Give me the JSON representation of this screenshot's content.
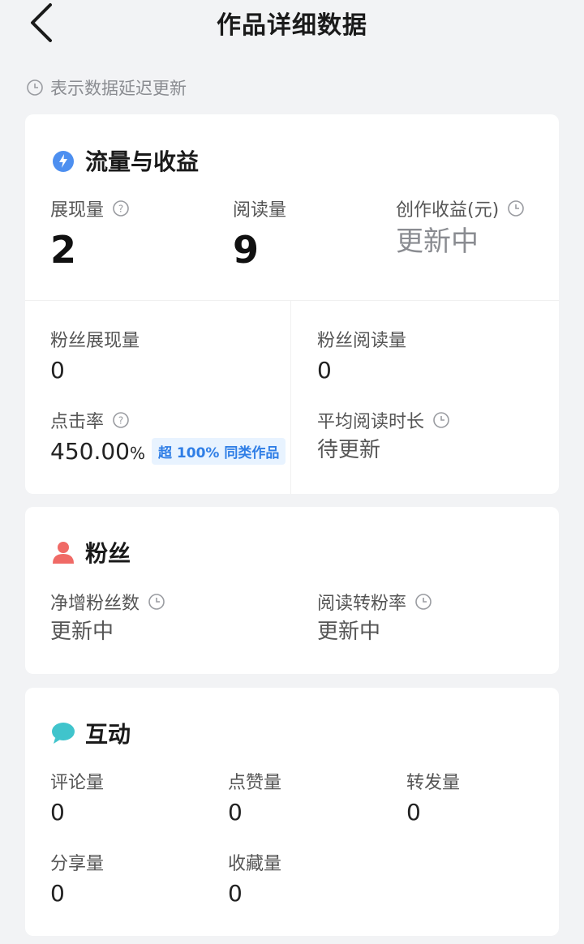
{
  "header": {
    "title": "作品详细数据"
  },
  "delay_note": "表示数据延迟更新",
  "traffic": {
    "title": "流量与收益",
    "impressions": {
      "label": "展现量",
      "value": "2"
    },
    "reads": {
      "label": "阅读量",
      "value": "9"
    },
    "earnings": {
      "label": "创作收益(元)",
      "value": "更新中"
    },
    "fan_impressions": {
      "label": "粉丝展现量",
      "value": "0"
    },
    "fan_reads": {
      "label": "粉丝阅读量",
      "value": "0"
    },
    "ctr": {
      "label": "点击率",
      "value": "450.00",
      "unit": "%",
      "badge": "超 100% 同类作品"
    },
    "avg_read_time": {
      "label": "平均阅读时长",
      "value": "待更新"
    }
  },
  "fans": {
    "title": "粉丝",
    "net_new": {
      "label": "净增粉丝数",
      "value": "更新中"
    },
    "read_to_fan": {
      "label": "阅读转粉率",
      "value": "更新中"
    }
  },
  "interaction": {
    "title": "互动",
    "comments": {
      "label": "评论量",
      "value": "0"
    },
    "likes": {
      "label": "点赞量",
      "value": "0"
    },
    "reposts": {
      "label": "转发量",
      "value": "0"
    },
    "shares": {
      "label": "分享量",
      "value": "0"
    },
    "favorites": {
      "label": "收藏量",
      "value": "0"
    }
  },
  "colors": {
    "traffic_icon": "#4d8ff0",
    "fans_icon": "#f06a66",
    "interaction_icon": "#40c4cc",
    "badge_bg": "#e8f3ff",
    "badge_text": "#2f7ee6"
  },
  "icons": {
    "back": "chevron-left-icon",
    "delay": "clock-icon",
    "help": "question-circle-icon"
  }
}
